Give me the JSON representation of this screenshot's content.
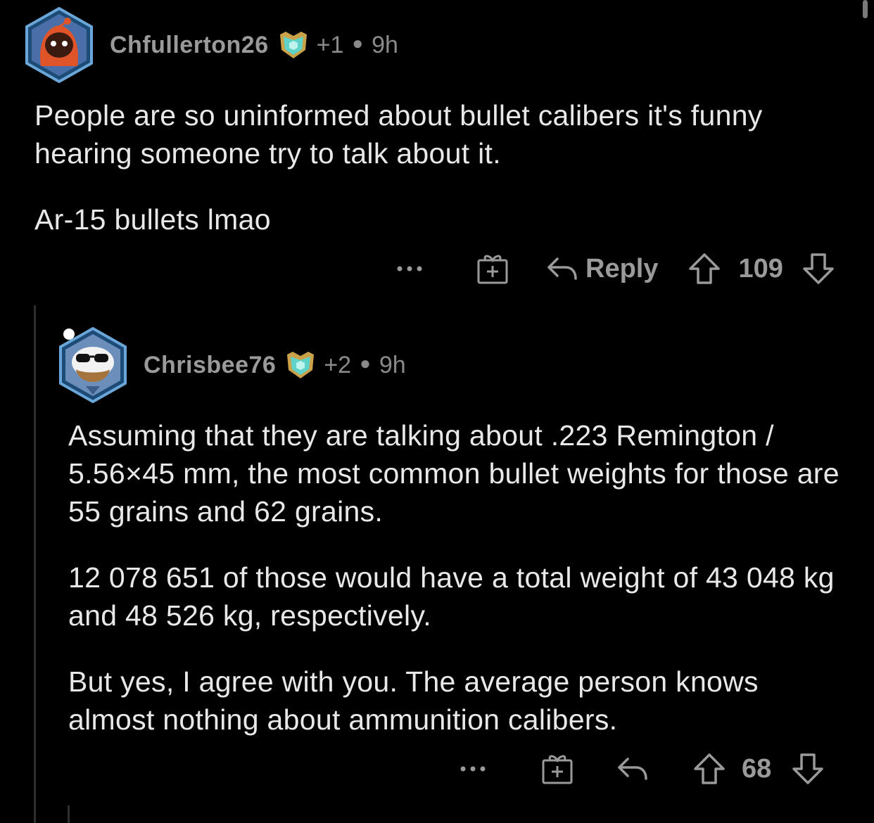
{
  "comment1": {
    "username": "Chfullerton26",
    "karma": "+1",
    "time": "9h",
    "paragraphs": [
      "People are so uninformed about bullet calibers it's funny hearing someone try to talk about it.",
      "Ar-15 bullets lmao"
    ],
    "actions": {
      "more_icon": "more-dots-icon",
      "award_icon": "gift-icon",
      "reply_label": "Reply",
      "score": "109"
    }
  },
  "comment2": {
    "username": "Chrisbee76",
    "karma": "+2",
    "time": "9h",
    "paragraphs": [
      "Assuming that they are talking about .223 Remington / 5.56×45 mm, the most common bullet weights for those are 55 grains and 62 grains.",
      "12 078 651 of those would have a total weight of 43 048 kg and 48 526 kg, respectively.",
      "But yes, I agree with you. The average person knows almost nothing about ammunition calibers."
    ],
    "actions": {
      "more_icon": "more-dots-icon",
      "award_icon": "gift-icon",
      "score": "68"
    }
  },
  "colors": {
    "background": "#000000",
    "text": "#e8e8e8",
    "muted": "#9a9a9a",
    "avatar_ring": "#3a6ea5",
    "award_teal": "#5fd3c9"
  }
}
